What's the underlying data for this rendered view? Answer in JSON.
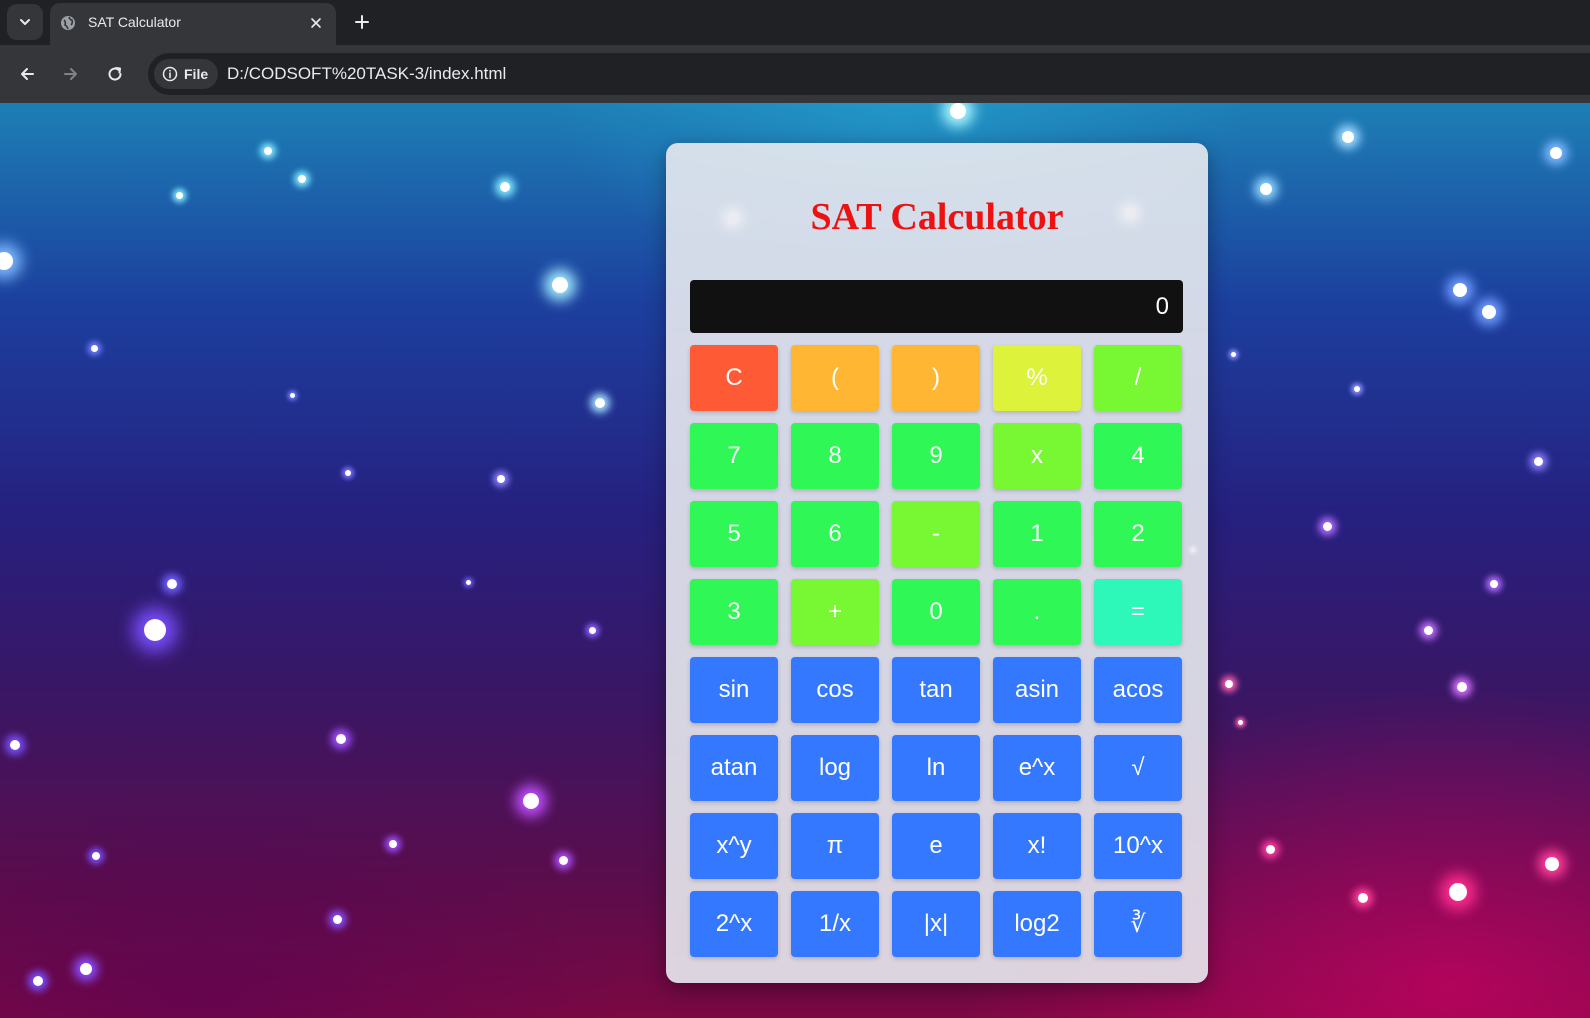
{
  "browser": {
    "tab_title": "SAT Calculator",
    "site_chip_label": "File",
    "url": "D:/CODSOFT%20TASK-3/index.html",
    "icons": {
      "tab_list": "chevron-down-icon",
      "favicon": "globe-icon",
      "tab_close": "close-icon",
      "new_tab": "plus-icon",
      "back": "back-arrow-icon",
      "forward": "forward-arrow-icon",
      "reload": "reload-icon",
      "site_info": "info-icon"
    }
  },
  "calculator": {
    "title": "SAT Calculator",
    "display_value": "0",
    "colors": {
      "title": "#ee1111",
      "clear": "#ff5a36",
      "paren": "#ffb733",
      "percent": "#ddf23a",
      "operator": "#78f833",
      "digit": "#2ef756",
      "equals": "#2ef7ba",
      "function": "#3478ff"
    },
    "keys": [
      {
        "label": "C",
        "kind": "clear"
      },
      {
        "label": "(",
        "kind": "paren"
      },
      {
        "label": ")",
        "kind": "paren"
      },
      {
        "label": "%",
        "kind": "percent"
      },
      {
        "label": "/",
        "kind": "operator"
      },
      {
        "label": "7",
        "kind": "digit"
      },
      {
        "label": "8",
        "kind": "digit"
      },
      {
        "label": "9",
        "kind": "digit"
      },
      {
        "label": "x",
        "kind": "operator"
      },
      {
        "label": "4",
        "kind": "digit"
      },
      {
        "label": "5",
        "kind": "digit"
      },
      {
        "label": "6",
        "kind": "digit"
      },
      {
        "label": "-",
        "kind": "operator"
      },
      {
        "label": "1",
        "kind": "digit"
      },
      {
        "label": "2",
        "kind": "digit"
      },
      {
        "label": "3",
        "kind": "digit"
      },
      {
        "label": "+",
        "kind": "operator"
      },
      {
        "label": "0",
        "kind": "digit"
      },
      {
        "label": ".",
        "kind": "digit"
      },
      {
        "label": "=",
        "kind": "equals"
      },
      {
        "label": "sin",
        "kind": "function"
      },
      {
        "label": "cos",
        "kind": "function"
      },
      {
        "label": "tan",
        "kind": "function"
      },
      {
        "label": "asin",
        "kind": "function"
      },
      {
        "label": "acos",
        "kind": "function"
      },
      {
        "label": "atan",
        "kind": "function"
      },
      {
        "label": "log",
        "kind": "function"
      },
      {
        "label": "ln",
        "kind": "function"
      },
      {
        "label": "e^x",
        "kind": "function"
      },
      {
        "label": "√",
        "kind": "function"
      },
      {
        "label": "x^y",
        "kind": "function"
      },
      {
        "label": "π",
        "kind": "function"
      },
      {
        "label": "e",
        "kind": "function"
      },
      {
        "label": "x!",
        "kind": "function"
      },
      {
        "label": "10^x",
        "kind": "function"
      },
      {
        "label": "2^x",
        "kind": "function"
      },
      {
        "label": "1/x",
        "kind": "function"
      },
      {
        "label": "|x|",
        "kind": "function"
      },
      {
        "label": "log2",
        "kind": "function"
      },
      {
        "label": "∛",
        "kind": "function"
      }
    ]
  }
}
